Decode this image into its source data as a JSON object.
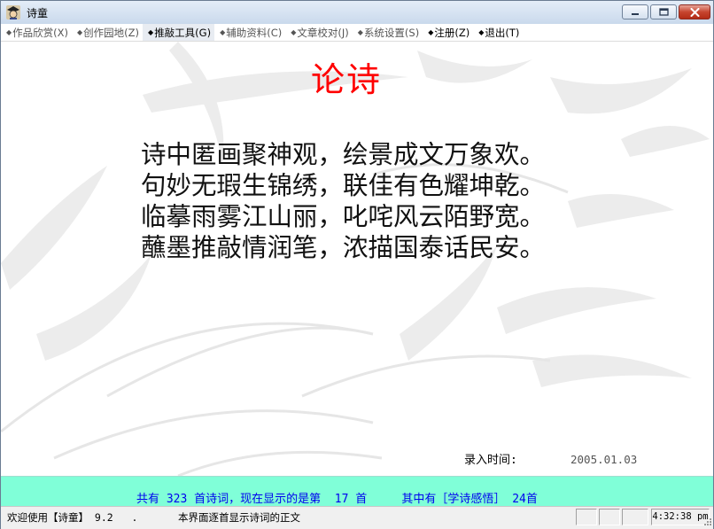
{
  "window": {
    "title": "诗童"
  },
  "menu": {
    "items": [
      {
        "label": "作品欣赏(X)",
        "state": "normal"
      },
      {
        "label": "创作园地(Z)",
        "state": "normal"
      },
      {
        "label": "推敲工具(G)",
        "state": "active"
      },
      {
        "label": "辅助资料(C)",
        "state": "normal"
      },
      {
        "label": "文章校对(J)",
        "state": "normal"
      },
      {
        "label": "系统设置(S)",
        "state": "normal"
      },
      {
        "label": "注册(Z)",
        "state": "black"
      },
      {
        "label": "退出(T)",
        "state": "black"
      }
    ]
  },
  "poem": {
    "title": "论诗",
    "lines": [
      "诗中匿画聚神观，绘景成文万象欢。",
      "句妙无瑕生锦绣，联佳有色耀坤乾。",
      "临摹雨雾江山丽，叱咤风云陌野宽。",
      "蘸墨推敲情润笔，浓描国泰话民安。"
    ],
    "entry_label": "录入时间:",
    "entry_date": "2005.01.03"
  },
  "info": {
    "text": "共有 323 首诗词，现在显示的是第  17 首     其中有［学诗感悟］ 24首"
  },
  "status": {
    "left_text": "欢迎使用【诗童】 9.2   .",
    "mid_text": "本界面逐首显示诗词的正文",
    "time": "4:32:38 pm"
  },
  "colors": {
    "title_red": "#ff0000",
    "info_band": "#80ffd8",
    "info_text": "#0000ee"
  },
  "icons": {
    "app": "scholar-icon",
    "minimize": "minimize-icon",
    "maximize": "maximize-icon",
    "close": "close-icon",
    "menu_bullet": "diamond-bullet-icon",
    "grip": "resize-grip-icon"
  }
}
